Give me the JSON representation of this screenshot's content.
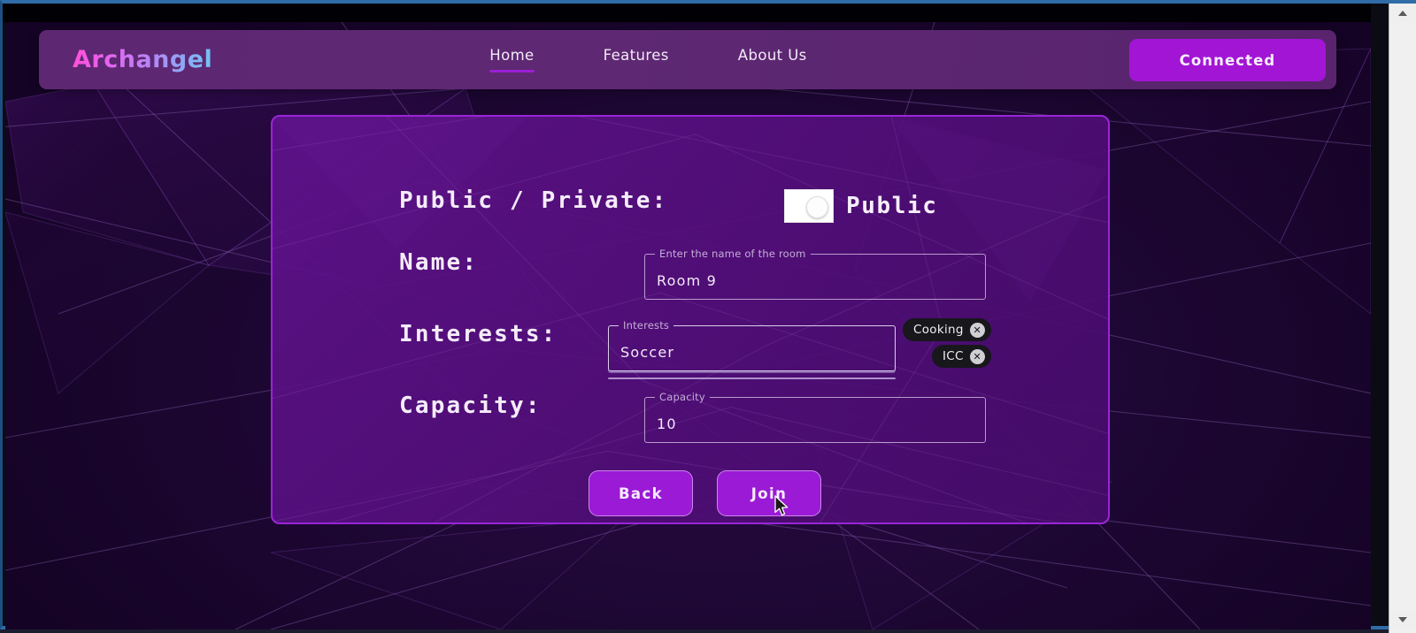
{
  "header": {
    "logo": "Archangel",
    "nav_items": [
      {
        "label": "Home",
        "active": true
      },
      {
        "label": "Features",
        "active": false
      },
      {
        "label": "About Us",
        "active": false
      }
    ],
    "connect_button": "Connected"
  },
  "form": {
    "visibility": {
      "label": "Public / Private:",
      "value": "Public",
      "toggle_state": "on"
    },
    "name": {
      "label": "Name:",
      "field_label": "Enter the name of the room",
      "value": "Room 9"
    },
    "interests": {
      "label": "Interests:",
      "field_label": "Interests",
      "value": "Soccer",
      "chips": [
        {
          "label": "Cooking",
          "delete": "✕"
        },
        {
          "label": "ICC",
          "delete": "✕"
        }
      ]
    },
    "capacity": {
      "label": "Capacity:",
      "field_label": "Capacity",
      "value": "10"
    },
    "actions": {
      "back": "Back",
      "join": "Join"
    }
  },
  "colors": {
    "accent_purple": "#9b1ad6",
    "connect_purple": "#a215d4",
    "card_border": "#9a25d8",
    "nav_bar": "#5d2771",
    "page_bg": "#1d0733",
    "chip_bg": "#17171c",
    "logo_gradient_start": "#ff4fd8",
    "logo_gradient_end": "#6fc7f2"
  },
  "icons": {
    "scroll_up": "scroll-up-arrow-icon",
    "scroll_down": "scroll-down-arrow-icon",
    "mouse": "mouse-pointer-icon"
  }
}
